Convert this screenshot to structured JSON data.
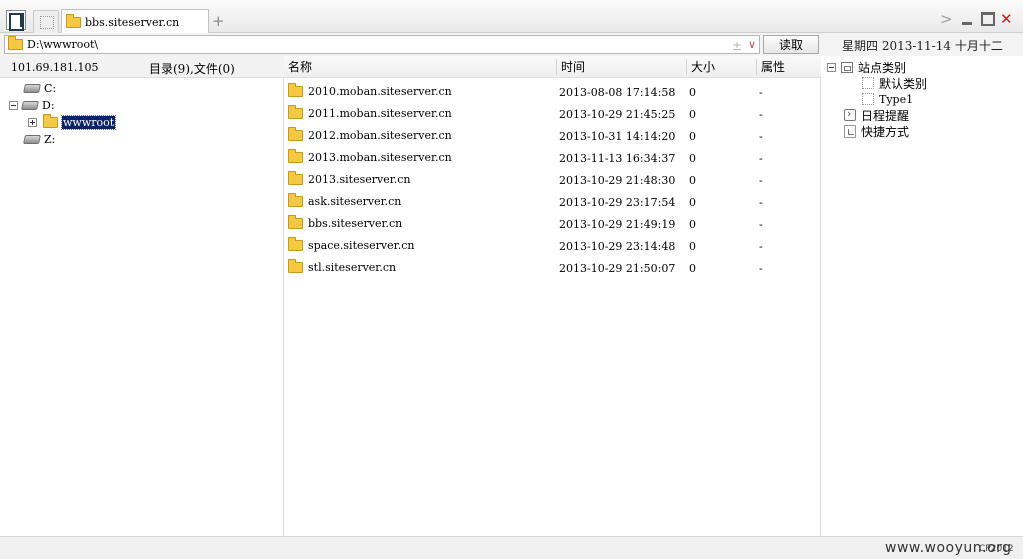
{
  "tab": {
    "title": "bbs.siteserver.cn"
  },
  "address": {
    "path": "D:\\wwwroot\\",
    "read_label": "读取"
  },
  "date_text": "星期四 2013-11-14 十月十二",
  "left": {
    "ip": "101.69.181.105",
    "counts": "目录(9),文件(0)",
    "tree": [
      {
        "label": "C:"
      },
      {
        "label": "D:"
      },
      {
        "label": "wwwroot"
      },
      {
        "label": "Z:"
      }
    ]
  },
  "columns": {
    "name": "名称",
    "time": "时间",
    "size": "大小",
    "attr": "属性"
  },
  "files": [
    {
      "name": "2010.moban.siteserver.cn",
      "time": "2013-08-08 17:14:58",
      "size": "0",
      "attr": "-"
    },
    {
      "name": "2011.moban.siteserver.cn",
      "time": "2013-10-29 21:45:25",
      "size": "0",
      "attr": "-"
    },
    {
      "name": "2012.moban.siteserver.cn",
      "time": "2013-10-31 14:14:20",
      "size": "0",
      "attr": "-"
    },
    {
      "name": "2013.moban.siteserver.cn",
      "time": "2013-11-13 16:34:37",
      "size": "0",
      "attr": "-"
    },
    {
      "name": "2013.siteserver.cn",
      "time": "2013-10-29 21:48:30",
      "size": "0",
      "attr": "-"
    },
    {
      "name": "ask.siteserver.cn",
      "time": "2013-10-29 23:17:54",
      "size": "0",
      "attr": "-"
    },
    {
      "name": "bbs.siteserver.cn",
      "time": "2013-10-29 21:49:19",
      "size": "0",
      "attr": "-"
    },
    {
      "name": "space.siteserver.cn",
      "time": "2013-10-29 23:14:48",
      "size": "0",
      "attr": "-"
    },
    {
      "name": "stl.siteserver.cn",
      "time": "2013-10-29 21:50:07",
      "size": "0",
      "attr": "-"
    }
  ],
  "right": {
    "site_category": "站点类别",
    "default_category": "默认类别",
    "type1": "Type1",
    "schedule": "日程提醒",
    "shortcuts": "快捷方式"
  },
  "status": {
    "build": "CP2012",
    "watermark": "www.wooyun.org"
  }
}
